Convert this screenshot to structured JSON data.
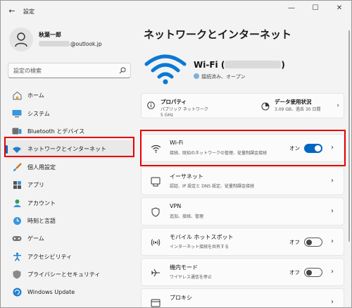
{
  "app": {
    "title": "設定",
    "back_glyph": "←",
    "controls": [
      "—",
      "☐",
      "✕"
    ]
  },
  "user": {
    "name": "秋葉一郎",
    "email_domain": "@outlook.jp"
  },
  "search": {
    "placeholder": "設定の検索"
  },
  "sidebar": {
    "items": [
      {
        "label": "ホーム",
        "icon": "home-icon"
      },
      {
        "label": "システム",
        "icon": "monitor-icon"
      },
      {
        "label": "Bluetooth とデバイス",
        "icon": "bluetooth-icon"
      },
      {
        "label": "ネットワークとインターネット",
        "icon": "wifi-icon",
        "active": true
      },
      {
        "label": "個人用設定",
        "icon": "brush-icon"
      },
      {
        "label": "アプリ",
        "icon": "apps-icon"
      },
      {
        "label": "アカウント",
        "icon": "account-icon"
      },
      {
        "label": "時刻と言語",
        "icon": "clock-globe-icon"
      },
      {
        "label": "ゲーム",
        "icon": "gamepad-icon"
      },
      {
        "label": "アクセシビリティ",
        "icon": "accessibility-icon"
      },
      {
        "label": "プライバシーとセキュリティ",
        "icon": "shield-icon"
      },
      {
        "label": "Windows Update",
        "icon": "update-icon"
      }
    ]
  },
  "main": {
    "title": "ネットワークとインターネット",
    "connection": {
      "name_prefix": "Wi-Fi (",
      "name_suffix": ")",
      "status": "接続済み、オープン"
    },
    "properties": {
      "title": "プロパティ",
      "sub1": "パブリック ネットワーク",
      "sub2": "5 GHz"
    },
    "data_usage": {
      "title": "データ使用状況",
      "sub": "3.09 GB、過去 30 日間"
    },
    "cards": [
      {
        "title": "Wi-Fi",
        "sub": "接続、既知のネットワークの管理、従量制課金接続",
        "state": "オン",
        "toggle": "on",
        "icon": "wifi-icon"
      },
      {
        "title": "イーサネット",
        "sub": "認証、IP 設定と DNS 設定、従量制課金接続",
        "icon": "ethernet-icon"
      },
      {
        "title": "VPN",
        "sub": "追加、接続、管理",
        "icon": "shield-icon"
      },
      {
        "title": "モバイル ホットスポット",
        "sub": "インターネット接続を共有する",
        "state": "オフ",
        "toggle": "off",
        "icon": "hotspot-icon"
      },
      {
        "title": "機内モード",
        "sub": "ワイヤレス通信を停止",
        "state": "オフ",
        "toggle": "off",
        "icon": "airplane-icon"
      },
      {
        "title": "プロキシ",
        "sub": "",
        "icon": "proxy-icon"
      }
    ]
  },
  "colors": {
    "accent": "#0067c0",
    "highlight": "#e60000"
  }
}
